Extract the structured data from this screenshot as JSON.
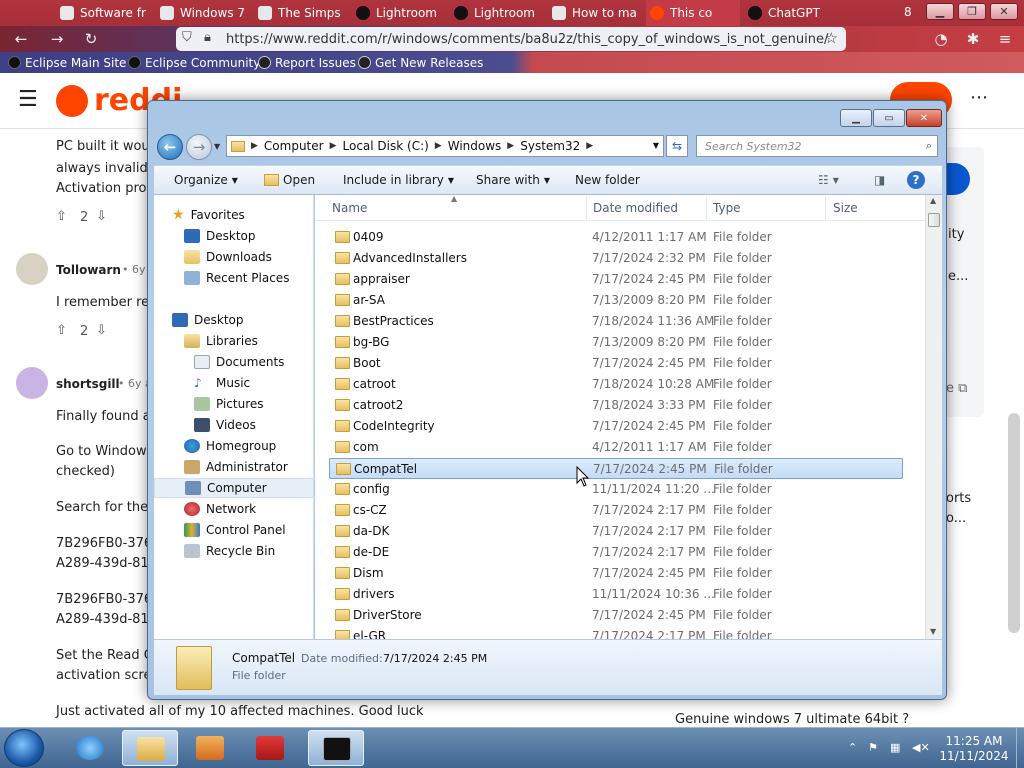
{
  "browser": {
    "tabs": [
      {
        "label": "Software fr",
        "active": false
      },
      {
        "label": "Windows 7",
        "active": false
      },
      {
        "label": "The Simps",
        "active": false
      },
      {
        "label": "Lightroom",
        "active": false
      },
      {
        "label": "Lightroom",
        "active": false
      },
      {
        "label": "How to ma",
        "active": false
      },
      {
        "label": "This co",
        "active": true
      },
      {
        "label": "ChatGPT",
        "active": false
      }
    ],
    "tab_count": "8",
    "url": "https://www.reddit.com/r/windows/comments/ba8u2z/this_copy_of_windows_is_not_genuine/",
    "bookmarks": [
      "Eclipse Main Site",
      "Eclipse Community",
      "Report Issues",
      "Get New Releases"
    ]
  },
  "reddit": {
    "logo_text": "reddi",
    "comment_lines_top": [
      "PC built it wou",
      "always invalid/t",
      "Activation proc"
    ],
    "votes_1": "2",
    "user_1": "Tollowarn",
    "time_1": "• 6y a",
    "text_1": "I remember rea",
    "votes_2": "2",
    "user_2": "shortsgill",
    "time_2": "• 6y ag",
    "text_2_lines": [
      "Finally found a",
      "Go to Windows",
      "checked)",
      "Search for thes",
      "7B296FB0-376",
      "A289-439d-81",
      "7B296FB0-376",
      "A289-439d-81",
      "Set the Read O",
      "activation scree",
      "Just activated all of my 10 affected machines. Good luck"
    ],
    "side_texts": [
      "ity",
      "e...",
      "orts",
      "o..."
    ],
    "related": "Genuine windows 7 ultimate 64bit ?"
  },
  "explorer": {
    "breadcrumb": [
      "Computer",
      "Local Disk (C:)",
      "Windows",
      "System32"
    ],
    "search_placeholder": "Search System32",
    "commands": [
      "Organize",
      "Open",
      "Include in library",
      "Share with",
      "New folder"
    ],
    "nav": {
      "favorites": "Favorites",
      "fav_items": [
        "Desktop",
        "Downloads",
        "Recent Places"
      ],
      "desktop": "Desktop",
      "libraries": "Libraries",
      "lib_items": [
        "Documents",
        "Music",
        "Pictures",
        "Videos"
      ],
      "other": [
        "Homegroup",
        "Administrator",
        "Computer",
        "Network",
        "Control Panel",
        "Recycle Bin"
      ]
    },
    "columns": [
      "Name",
      "Date modified",
      "Type",
      "Size"
    ],
    "files": [
      {
        "name": "0409",
        "date": "4/12/2011 1:17 AM",
        "type": "File folder"
      },
      {
        "name": "AdvancedInstallers",
        "date": "7/17/2024 2:32 PM",
        "type": "File folder"
      },
      {
        "name": "appraiser",
        "date": "7/17/2024 2:45 PM",
        "type": "File folder"
      },
      {
        "name": "ar-SA",
        "date": "7/13/2009 8:20 PM",
        "type": "File folder"
      },
      {
        "name": "BestPractices",
        "date": "7/18/2024 11:36 AM",
        "type": "File folder"
      },
      {
        "name": "bg-BG",
        "date": "7/13/2009 8:20 PM",
        "type": "File folder"
      },
      {
        "name": "Boot",
        "date": "7/17/2024 2:45 PM",
        "type": "File folder"
      },
      {
        "name": "catroot",
        "date": "7/18/2024 10:28 AM",
        "type": "File folder"
      },
      {
        "name": "catroot2",
        "date": "7/18/2024 3:33 PM",
        "type": "File folder"
      },
      {
        "name": "CodeIntegrity",
        "date": "7/17/2024 2:45 PM",
        "type": "File folder"
      },
      {
        "name": "com",
        "date": "4/12/2011 1:17 AM",
        "type": "File folder"
      },
      {
        "name": "CompatTel",
        "date": "7/17/2024 2:45 PM",
        "type": "File folder"
      },
      {
        "name": "config",
        "date": "11/11/2024 11:20 ...",
        "type": "File folder"
      },
      {
        "name": "cs-CZ",
        "date": "7/17/2024 2:17 PM",
        "type": "File folder"
      },
      {
        "name": "da-DK",
        "date": "7/17/2024 2:17 PM",
        "type": "File folder"
      },
      {
        "name": "de-DE",
        "date": "7/17/2024 2:17 PM",
        "type": "File folder"
      },
      {
        "name": "Dism",
        "date": "7/17/2024 2:45 PM",
        "type": "File folder"
      },
      {
        "name": "drivers",
        "date": "11/11/2024 10:36 ...",
        "type": "File folder"
      },
      {
        "name": "DriverStore",
        "date": "7/17/2024 2:45 PM",
        "type": "File folder"
      },
      {
        "name": "el-GR",
        "date": "7/17/2024 2:17 PM",
        "type": "File folder"
      }
    ],
    "selected_index": 11,
    "details": {
      "name": "CompatTel",
      "date_label": "Date modified:",
      "date": "7/17/2024 2:45 PM",
      "type": "File folder"
    }
  },
  "taskbar": {
    "time": "11:25 AM",
    "date": "11/11/2024"
  }
}
